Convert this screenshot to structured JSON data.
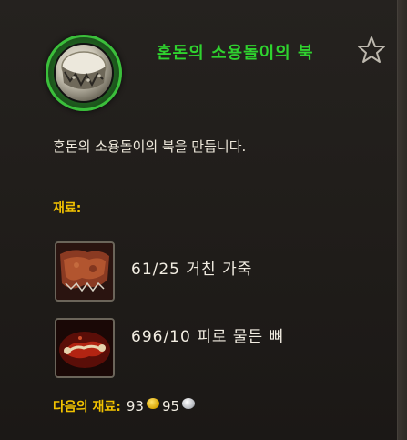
{
  "recipe": {
    "title": "혼돈의 소용돌이의 북",
    "description": "혼돈의 소용돌이의 북을 만듭니다."
  },
  "reagents": {
    "header": "재료:",
    "items": [
      {
        "count": "61/25",
        "name": "거친 가죽",
        "icon": "leather-icon"
      },
      {
        "count": "696/10",
        "name": "피로 물든 뼈",
        "icon": "bone-icon"
      }
    ]
  },
  "total": {
    "label": "다음의 재료:",
    "gold": "93",
    "silver": "95"
  },
  "colors": {
    "title": "#2fd32f",
    "header": "#f2c200",
    "ring": "#3bbf3b"
  }
}
